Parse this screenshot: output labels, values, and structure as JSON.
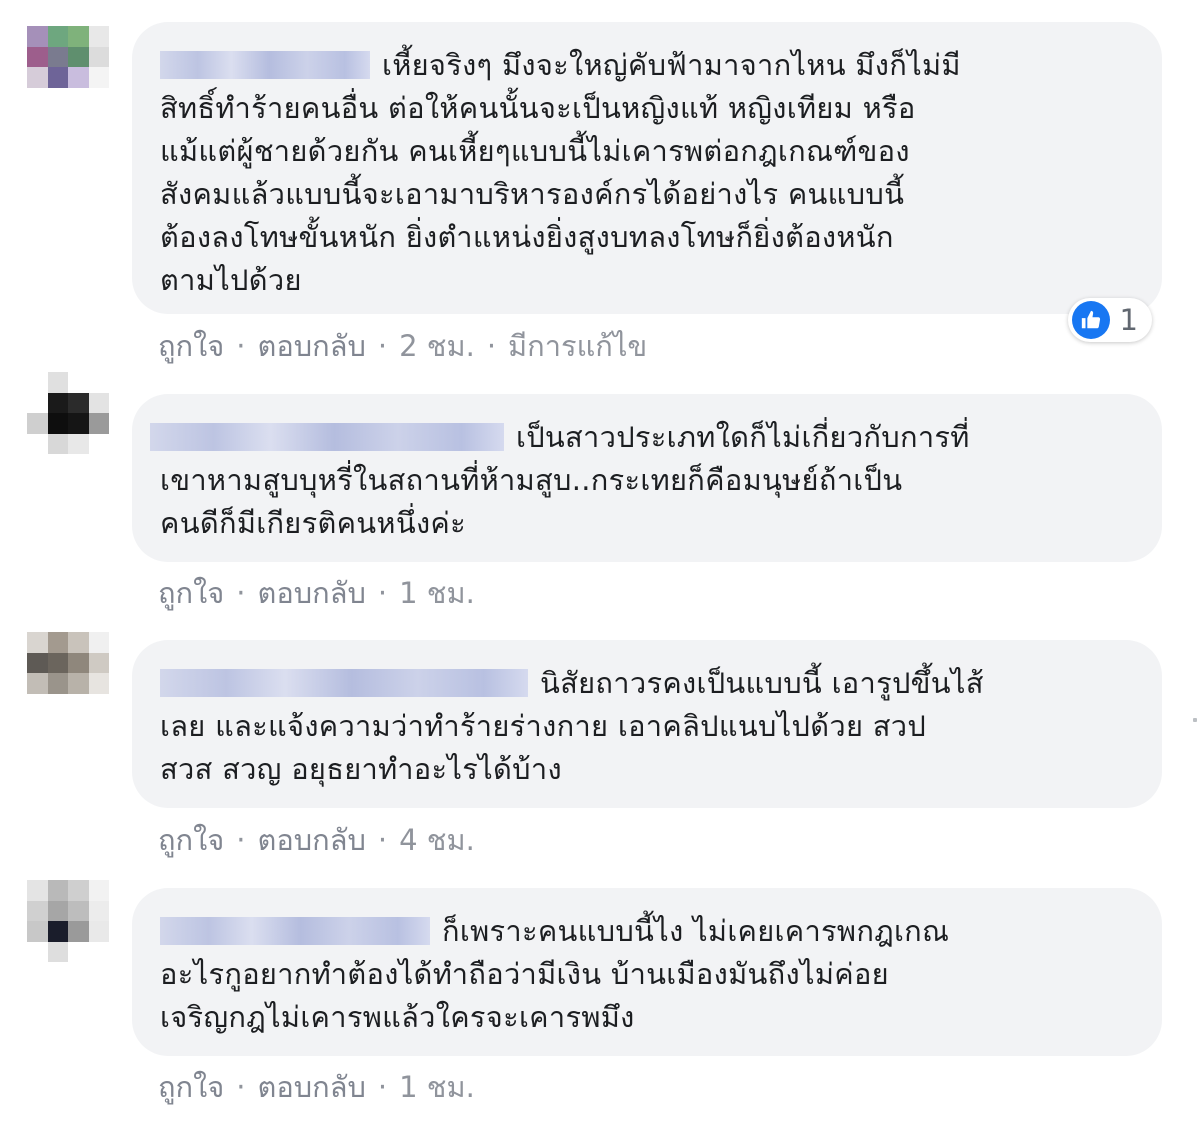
{
  "comments": [
    {
      "text_lines": [
        "เหี้ยจริงๆ มึงจะใหญ่คับฟ้ามาจากไหน มึงก็ไม่มี",
        "สิทธิ์ทำร้ายคนอื่น ต่อให้คนนั้นจะเป็นหญิงแท้ หญิงเทียม หรือ",
        "แม้แต่ผู้ชายด้วยกัน คนเหี้ยๆแบบนี้ไม่เคารพต่อกฎเกณฑ์ของ",
        "สังคมแล้วแบบนี้จะเอามาบริหารองค์กรได้อย่างไร คนแบบนี้",
        "ต้องลงโทษขั้นหนัก ยิ่งตำแหน่งยิ่งสูงบทลงโทษก็ยิ่งต้องหนัก",
        "ตามไปด้วย"
      ],
      "like_label": "ถูกใจ",
      "reply_label": "ตอบกลับ",
      "time": "2 ชม.",
      "edited_label": "มีการแก้ไข",
      "reaction_count": "1"
    },
    {
      "text_lines": [
        "เป็นสาวประเภทใดก็ไม่เกี่ยวกับการที่",
        "เขาหามสูบบุหรี่ในสถานที่ห้ามสูบ..กระเทยก็คือมนุษย์ถ้าเป็น",
        "คนดีก็มีเกียรติคนหนึ่งค่ะ"
      ],
      "like_label": "ถูกใจ",
      "reply_label": "ตอบกลับ",
      "time": "1 ชม."
    },
    {
      "text_lines": [
        "นิสัยถาวรคงเป็นแบบนี้ เอารูปขึ้นไส้",
        "เลย และแจ้งความว่าทำร้ายร่างกาย เอาคลิปแนบไปด้วย สวป",
        "สวส สวญ อยุธยาทำอะไรได้บ้าง"
      ],
      "like_label": "ถูกใจ",
      "reply_label": "ตอบกลับ",
      "time": "4 ชม."
    },
    {
      "text_lines": [
        "ก็เพราะคนแบบนี้ไง ไม่เคยเคารพกฎเกณ",
        "อะไรกูอยากทำต้องได้ทำถือว่ามีเงิน บ้านเมืองมันถึงไม่ค่อย",
        "เจริญกฎไม่เคารพแล้วใครจะเคารพมึง"
      ],
      "like_label": "ถูกใจ",
      "reply_label": "ตอบกลับ",
      "time": "1 ชม."
    }
  ],
  "separator": "·",
  "colors": {
    "bubble": "#f2f3f5",
    "meta_text": "#90949c",
    "like_blue": "#1877f2"
  },
  "icons": {
    "reaction": "like-thumbs-up-icon"
  }
}
